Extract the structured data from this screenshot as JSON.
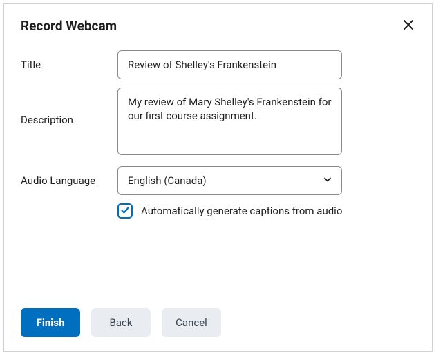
{
  "dialog": {
    "title": "Record Webcam"
  },
  "form": {
    "titleLabel": "Title",
    "titleValue": "Review of Shelley's Frankenstein",
    "descriptionLabel": "Description",
    "descriptionValue": "My review of Mary Shelley's Frankenstein for our first course assignment.",
    "languageLabel": "Audio Language",
    "languageValue": "English (Canada)",
    "captionsCheckboxLabel": "Automatically generate captions from audio",
    "captionsChecked": true
  },
  "footer": {
    "finish": "Finish",
    "back": "Back",
    "cancel": "Cancel"
  }
}
